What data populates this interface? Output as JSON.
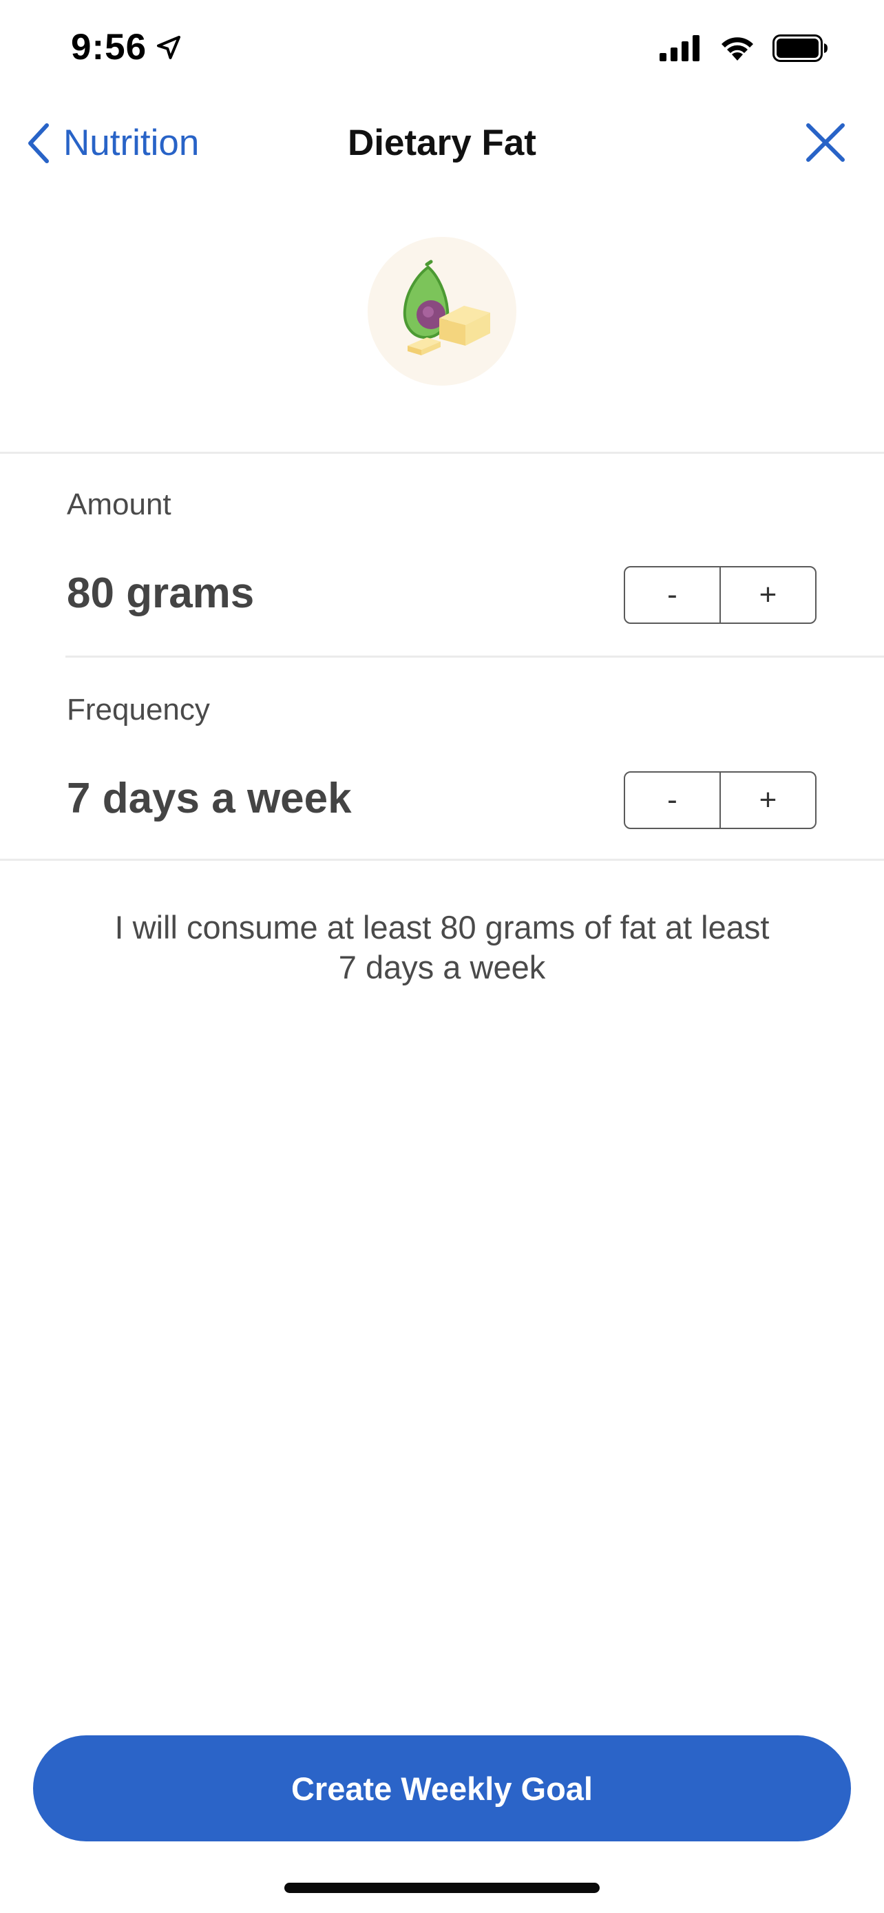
{
  "status_bar": {
    "time": "9:56"
  },
  "nav": {
    "back_label": "Nutrition",
    "title": "Dietary Fat"
  },
  "amount": {
    "label": "Amount",
    "value": "80 grams",
    "decrement": "-",
    "increment": "+"
  },
  "frequency": {
    "label": "Frequency",
    "value": "7 days a week",
    "decrement": "-",
    "increment": "+"
  },
  "summary": {
    "line1": "I will consume at least 80 grams of fat at least",
    "line2": "7 days a week"
  },
  "cta": {
    "label": "Create Weekly Goal"
  },
  "colors": {
    "accent": "#2b64c8",
    "link": "#2863c7",
    "hero_bg": "#fbf5ec"
  }
}
